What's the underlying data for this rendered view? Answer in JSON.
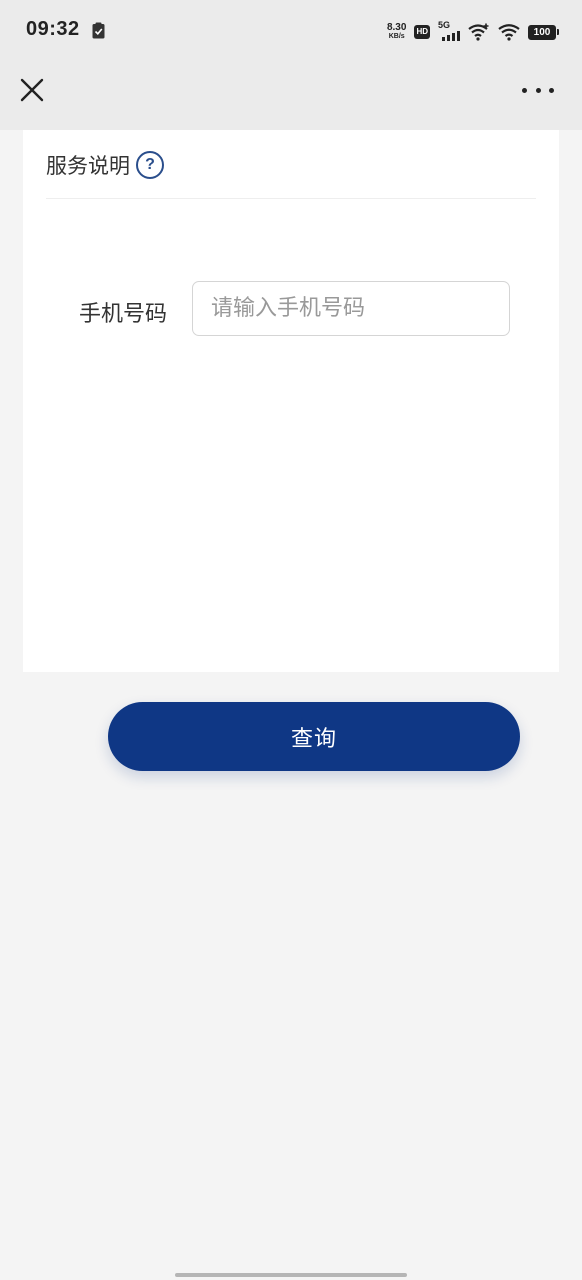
{
  "status_bar": {
    "time": "09:32",
    "net_speed_value": "8.30",
    "net_speed_unit": "KB/s",
    "hd_label": "HD",
    "network_label": "5G",
    "battery": "100"
  },
  "nav": {
    "close_icon": "close-icon",
    "more_icon": "more-dots-icon"
  },
  "service": {
    "label": "服务说明",
    "help_glyph": "?"
  },
  "form": {
    "phone_label": "手机号码",
    "phone_placeholder": "请输入手机号码",
    "phone_value": ""
  },
  "actions": {
    "query_label": "查询"
  },
  "colors": {
    "primary": "#0f3785",
    "help_icon": "#2a4e8c",
    "page_background": "#f4f4f4",
    "header_background": "#ebebeb"
  }
}
